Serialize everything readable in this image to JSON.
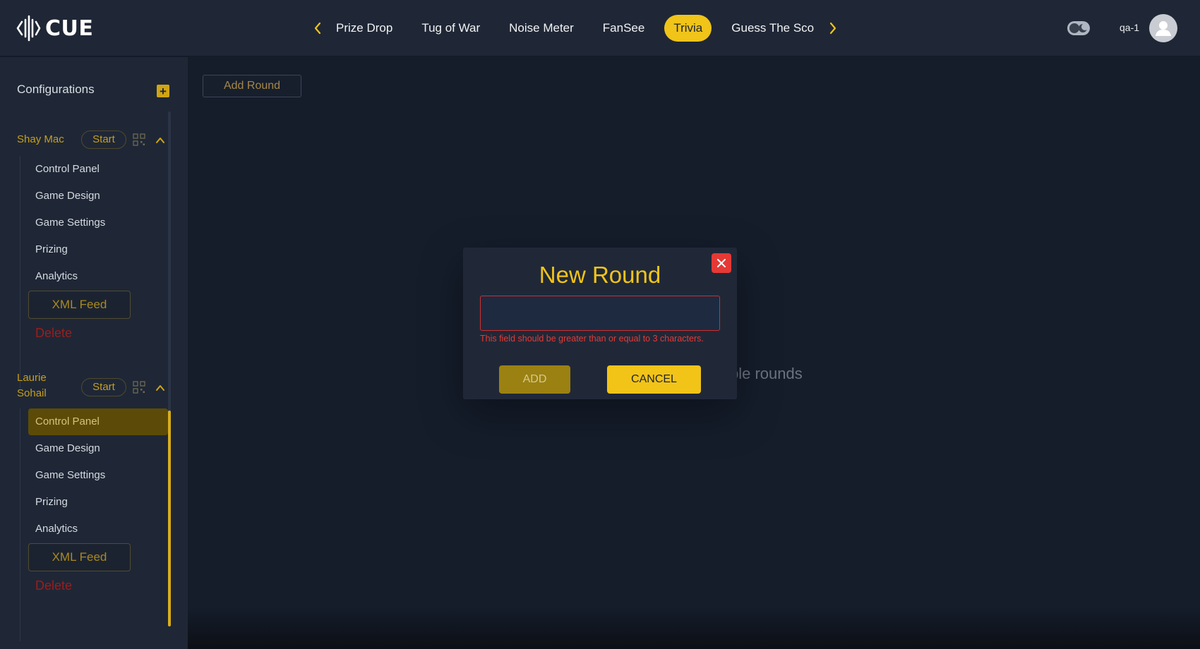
{
  "header": {
    "logo_text": "CUE",
    "tabs": [
      {
        "label": "Prize Drop",
        "active": false
      },
      {
        "label": "Tug of War",
        "active": false
      },
      {
        "label": "Noise Meter",
        "active": false
      },
      {
        "label": "FanSee",
        "active": false
      },
      {
        "label": "Trivia",
        "active": true
      },
      {
        "label": "Guess The Sco",
        "active": false
      }
    ],
    "username": "qa-1"
  },
  "sidebar": {
    "title": "Configurations",
    "configs": [
      {
        "name": "Shay Mac",
        "start_label": "Start",
        "items": [
          "Control Panel",
          "Game Design",
          "Game Settings",
          "Prizing",
          "Analytics"
        ],
        "xml_feed_label": "XML Feed",
        "delete_label": "Delete"
      },
      {
        "name_line1": "Laurie",
        "name_line2": "Sohail",
        "start_label": "Start",
        "items": [
          "Control Panel",
          "Game Design",
          "Game Settings",
          "Prizing",
          "Analytics"
        ],
        "active_item": "Control Panel",
        "xml_feed_label": "XML Feed",
        "delete_label": "Delete"
      }
    ]
  },
  "main": {
    "add_round_label": "Add Round",
    "empty_text_visible": "ble rounds"
  },
  "modal": {
    "title": "New Round",
    "input_value": "",
    "error_text": "This field should be greater than or equal to 3 characters.",
    "add_label": "ADD",
    "cancel_label": "CANCEL"
  },
  "colors": {
    "accent": "#f2c418",
    "error": "#e53935",
    "background": "#151d2b",
    "panel": "#1f2736"
  }
}
